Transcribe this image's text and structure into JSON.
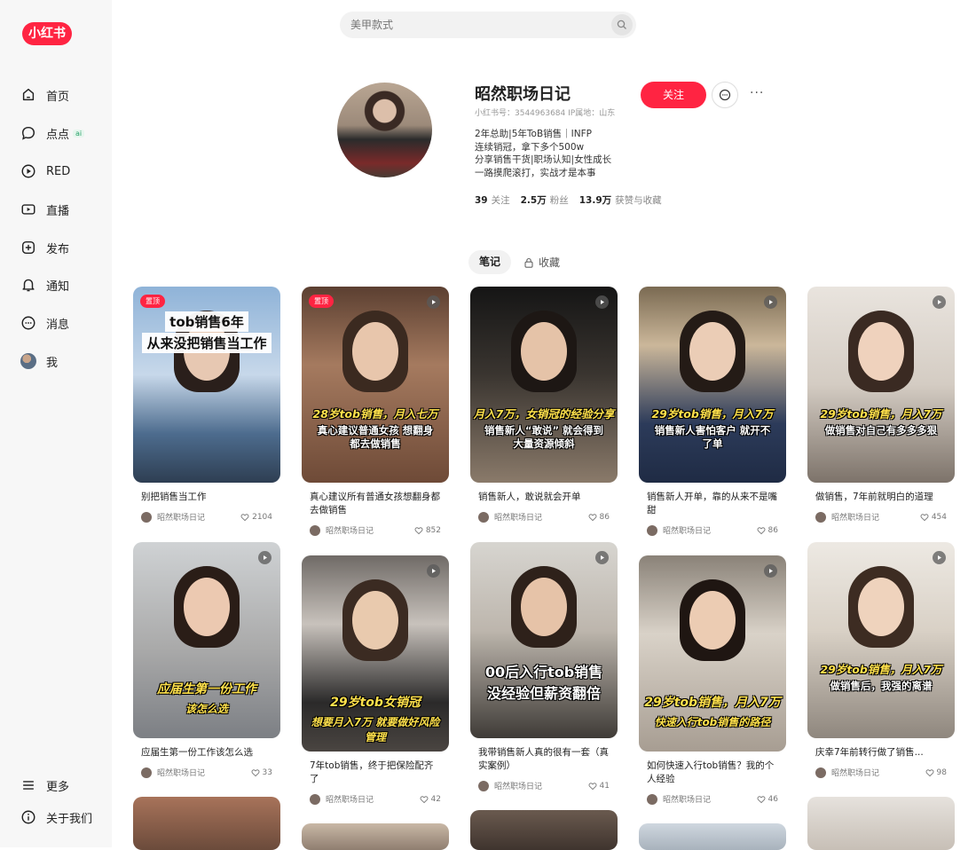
{
  "brand": {
    "logo_text": "小红书",
    "accent": "#ff2442"
  },
  "search": {
    "placeholder": "美甲款式"
  },
  "sidebar": {
    "items": [
      {
        "label": "首页",
        "icon": "home-icon"
      },
      {
        "label": "点点",
        "icon": "chat-bubble-icon",
        "badge": "ai"
      },
      {
        "label": "RED",
        "icon": "play-circle-icon"
      },
      {
        "label": "直播",
        "icon": "live-icon"
      },
      {
        "label": "发布",
        "icon": "plus-square-icon"
      },
      {
        "label": "通知",
        "icon": "bell-icon"
      },
      {
        "label": "消息",
        "icon": "message-icon"
      },
      {
        "label": "我",
        "icon": "avatar"
      }
    ],
    "bottom": [
      {
        "label": "更多",
        "icon": "menu-icon"
      },
      {
        "label": "关于我们",
        "icon": "info-icon"
      }
    ]
  },
  "profile": {
    "name": "昭然职场日记",
    "id_line": "小红书号：3544963684   IP属地：山东",
    "bio": [
      "2年总助|5年ToB销售｜INFP",
      "连续销冠，拿下多个500w",
      "分享销售干货|职场认知|女性成长",
      "一路摸爬滚打，实战才是本事"
    ],
    "follow_label": "关注",
    "stats": [
      {
        "num": "39",
        "label": "关注"
      },
      {
        "num": "2.5万",
        "label": "粉丝"
      },
      {
        "num": "13.9万",
        "label": "获赞与收藏"
      }
    ]
  },
  "tabs": {
    "notes": "笔记",
    "favorites": "收藏"
  },
  "author": "昭然职场日记",
  "cards": [
    {
      "title": "别把销售当工作",
      "likes": "2104",
      "pin": "置顶",
      "cap1": "tob销售6年",
      "cap2": "从来没把销售当工作",
      "style": "box"
    },
    {
      "title": "真心建议所有普通女孩想翻身都去做销售",
      "likes": "852",
      "pin": "置顶",
      "cap1": "28岁tob销售，月入七万",
      "cap2": "真心建议普通女孩 想翻身都去做销售",
      "style": "yw"
    },
    {
      "title": "销售新人，敢说就会开单",
      "likes": "86",
      "cap1": "月入7万，女销冠的经验分享",
      "cap2": "销售新人“敢说” 就会得到大量资源倾斜",
      "style": "yw"
    },
    {
      "title": "销售新人开单，靠的从来不是嘴甜",
      "likes": "86",
      "cap1": "29岁tob销售，月入7万",
      "cap2": "销售新人害怕客户 就开不了单",
      "style": "yw"
    },
    {
      "title": "做销售，7年前就明白的道理",
      "likes": "454",
      "cap1": "29岁tob销售，月入7万",
      "cap2": "做销售对自己有多多多狠",
      "style": "yw"
    },
    {
      "title": "应届生第一份工作该怎么选",
      "likes": "33",
      "cap1": "应届生第一份工作",
      "cap2": "该怎么选",
      "style": "yy"
    },
    {
      "title": "7年tob销售，终于把保险配齐了",
      "likes": "42",
      "cap1": "29岁tob女销冠",
      "cap2": "想要月入7万 就要做好风险管理",
      "style": "yy"
    },
    {
      "title": "我带销售新人真的很有一套（真实案例）",
      "likes": "41",
      "cap1": "00后入行tob销售",
      "cap2": "没经验但薪资翻倍",
      "style": "ww"
    },
    {
      "title": "如何快速入行tob销售？我的个人经验",
      "likes": "46",
      "cap1": "29岁tob销售，月入7万",
      "cap2": "快速入行tob销售的路径",
      "style": "yy"
    },
    {
      "title": "庆幸7年前转行做了销售...",
      "likes": "98",
      "cap1": "29岁tob销售，月入7万",
      "cap2": "做销售后，我强的离谱",
      "style": "yw"
    }
  ]
}
